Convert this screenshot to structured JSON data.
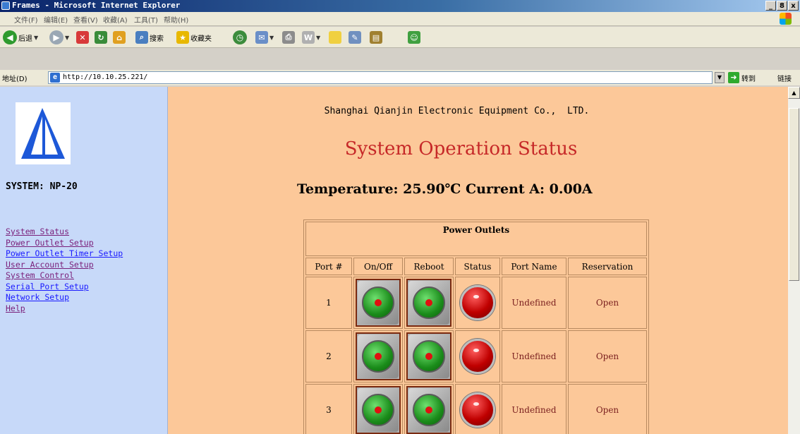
{
  "window": {
    "title": "Frames - Microsoft Internet Explorer",
    "controls": [
      "_",
      "8",
      "x"
    ]
  },
  "menubar": {
    "items": [
      "文件(F)",
      "编辑(E)",
      "查看(V)",
      "收藏(A)",
      "工具(T)",
      "帮助(H)"
    ]
  },
  "toolbar": {
    "back_label": "后退",
    "search_label": "搜索",
    "favorites_label": "收藏夹"
  },
  "address": {
    "label": "地址(D)",
    "url": "http://10.10.25.221/",
    "go_label": "转到",
    "links_label": "链接"
  },
  "sidebar": {
    "system_label": "SYSTEM: NP-20",
    "nav": [
      {
        "label": "System Status"
      },
      {
        "label": "Power Outlet Setup"
      },
      {
        "label": "Power Outlet Timer Setup"
      },
      {
        "label": "User Account Setup"
      },
      {
        "label": "System Control"
      },
      {
        "label": "Serial Port Setup"
      },
      {
        "label": "Network Setup"
      },
      {
        "label": "Help"
      }
    ]
  },
  "main": {
    "company": "Shanghai Qianjin Electronic Equipment Co.,  LTD.",
    "heading": "System Operation Status",
    "status_line": "Temperature: 25.90℃ Current A: 0.00A",
    "table": {
      "title": "Power Outlets",
      "columns": [
        "Port #",
        "On/Off",
        "Reboot",
        "Status",
        "Port Name",
        "Reservation"
      ],
      "rows": [
        {
          "port": "1",
          "name": "Undefined",
          "reservation": "Open"
        },
        {
          "port": "2",
          "name": "Undefined",
          "reservation": "Open"
        },
        {
          "port": "3",
          "name": "Undefined",
          "reservation": "Open"
        }
      ]
    }
  },
  "colors": {
    "sidebar_bg": "#c7d9f9",
    "content_bg": "#fcc899",
    "heading": "#c62828",
    "link": "#1a1aff",
    "visited_link": "#7a1f7a"
  }
}
